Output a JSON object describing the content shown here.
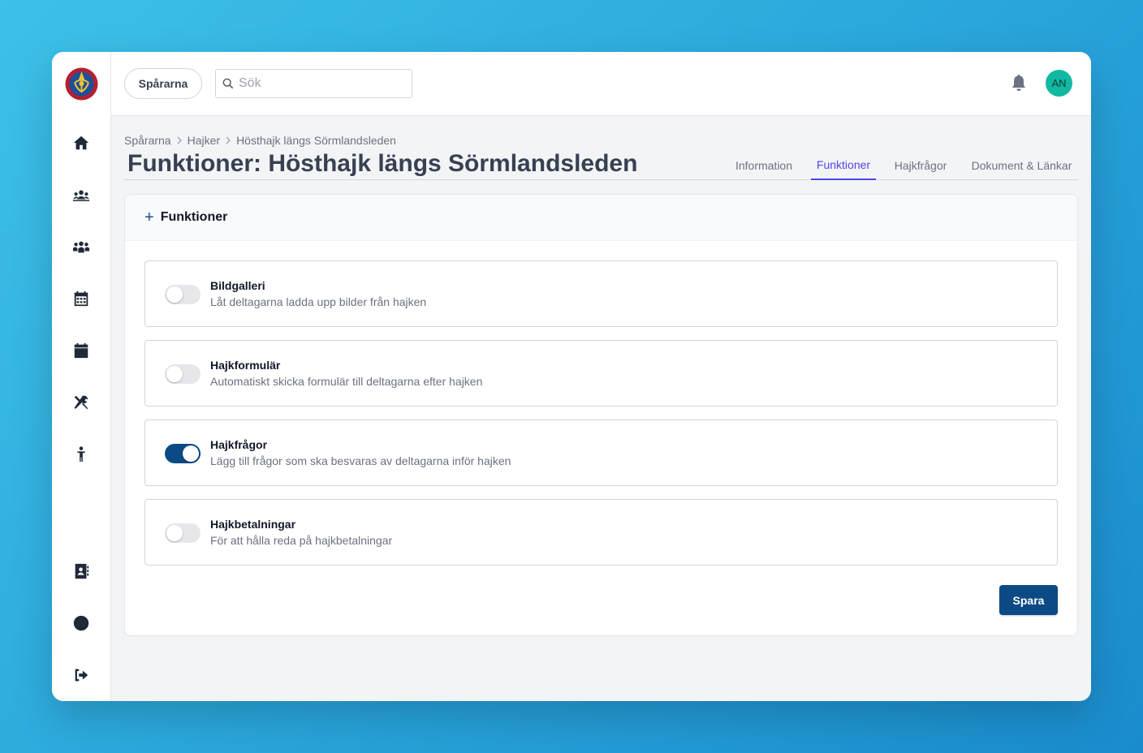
{
  "org_button": "Spårarna",
  "search": {
    "placeholder": "Sök",
    "value": ""
  },
  "avatar": "AN",
  "breadcrumb": [
    "Spårarna",
    "Hajker",
    "Hösthajk längs Sörmlandsleden"
  ],
  "page_title": "Funktioner: Hösthajk längs Sörmlandsleden",
  "tabs": [
    {
      "label": "Information",
      "active": false
    },
    {
      "label": "Funktioner",
      "active": true
    },
    {
      "label": "Hajkfrågor",
      "active": false
    },
    {
      "label": "Dokument & Länkar",
      "active": false
    }
  ],
  "card": {
    "header_icon": "+",
    "header_title": "Funktioner",
    "features": [
      {
        "name": "Bildgalleri",
        "description": "Låt deltagarna ladda upp bilder från hajken",
        "enabled": false
      },
      {
        "name": "Hajkformulär",
        "description": "Automatiskt skicka formulär till deltagarna efter hajken",
        "enabled": false
      },
      {
        "name": "Hajkfrågor",
        "description": "Lägg till frågor som ska besvaras av deltagarna inför hajken",
        "enabled": true
      },
      {
        "name": "Hajkbetalningar",
        "description": "För att hålla reda på hajkbetalningar",
        "enabled": false
      }
    ],
    "save_label": "Spara"
  },
  "sidebar_icons": [
    "home-icon",
    "group-icon",
    "people-icon",
    "calendar-grid-icon",
    "calendar-icon",
    "tools-icon",
    "child-icon",
    "contacts-icon",
    "globe-icon",
    "logout-icon"
  ],
  "colors": {
    "primary": "#0b4a85",
    "tab_active": "#4f46e5",
    "avatar_bg": "#10b9a0"
  }
}
